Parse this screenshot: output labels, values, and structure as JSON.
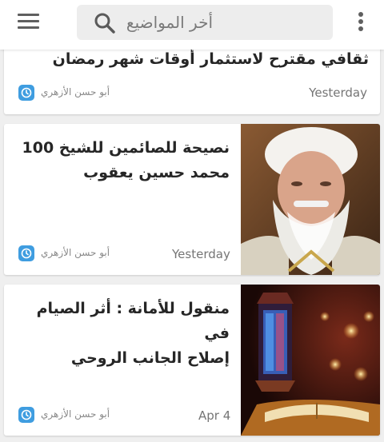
{
  "header": {
    "search_placeholder": "أخر المواضيع",
    "menu_icon": "hamburger-menu-icon",
    "search_icon": "search-icon",
    "more_icon": "more-vertical-icon"
  },
  "posts": [
    {
      "title_lines": [
        "ثقافي مقترح لاستثمار أوقات شهر رمضان"
      ],
      "author": "أبو حسن الأزهري",
      "date": "Yesterday",
      "has_image": false
    },
    {
      "title_lines": [
        "نصيحة للصائمين للشيخ 100",
        "محمد حسين يعقوب"
      ],
      "author": "أبو حسن الأزهري",
      "date": "Yesterday",
      "has_image": true,
      "image": "sheikh-portrait-photo"
    },
    {
      "title_lines": [
        "منقول للأمانة : أثر الصيام في",
        "إصلاح الجانب الروحي"
      ],
      "author": "أبو حسن الأزهري",
      "date": "Apr 4",
      "has_image": true,
      "image": "ramadan-lantern-quran-photo"
    }
  ],
  "colors": {
    "accent": "#3f9de0",
    "background": "#efefef",
    "card": "#ffffff"
  }
}
